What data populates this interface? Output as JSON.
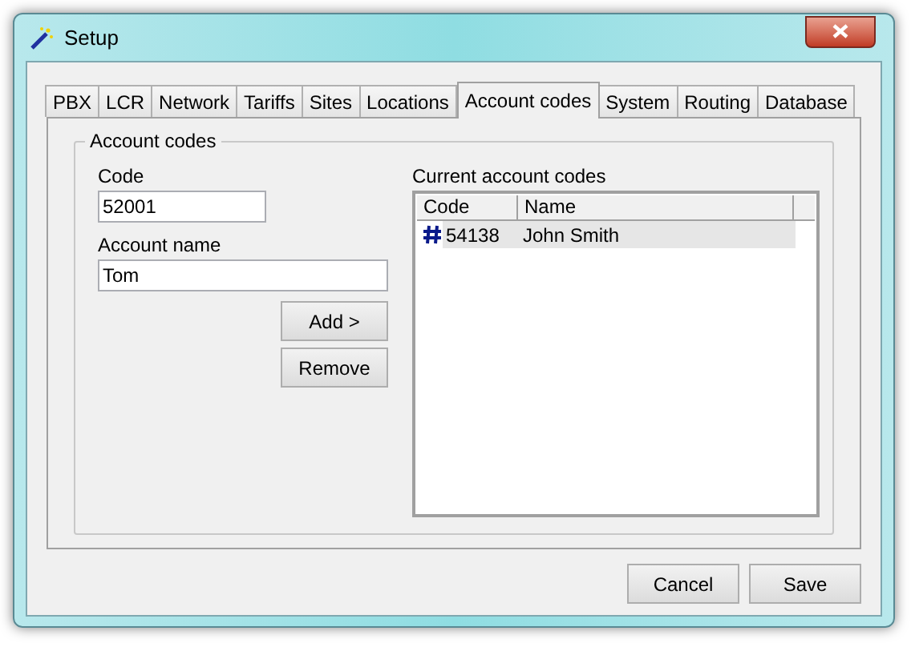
{
  "window": {
    "title": "Setup"
  },
  "tabs": [
    {
      "label": "PBX",
      "selected": false
    },
    {
      "label": "LCR",
      "selected": false
    },
    {
      "label": "Network",
      "selected": false
    },
    {
      "label": "Tariffs",
      "selected": false
    },
    {
      "label": "Sites",
      "selected": false
    },
    {
      "label": "Locations",
      "selected": false
    },
    {
      "label": "Account codes",
      "selected": true
    },
    {
      "label": "System",
      "selected": false
    },
    {
      "label": "Routing",
      "selected": false
    },
    {
      "label": "Database",
      "selected": false
    }
  ],
  "group": {
    "title": "Account codes"
  },
  "code_field": {
    "label": "Code",
    "value": "52001"
  },
  "name_field": {
    "label": "Account name",
    "value": "Tom"
  },
  "form_buttons": [
    "Add >",
    "Remove"
  ],
  "list": {
    "label": "Current account codes",
    "columns": [
      "Code",
      "Name"
    ],
    "rows": [
      {
        "code": "54138",
        "name": "John Smith",
        "selected": true
      }
    ]
  },
  "buttons": [
    "Cancel",
    "Save"
  ]
}
